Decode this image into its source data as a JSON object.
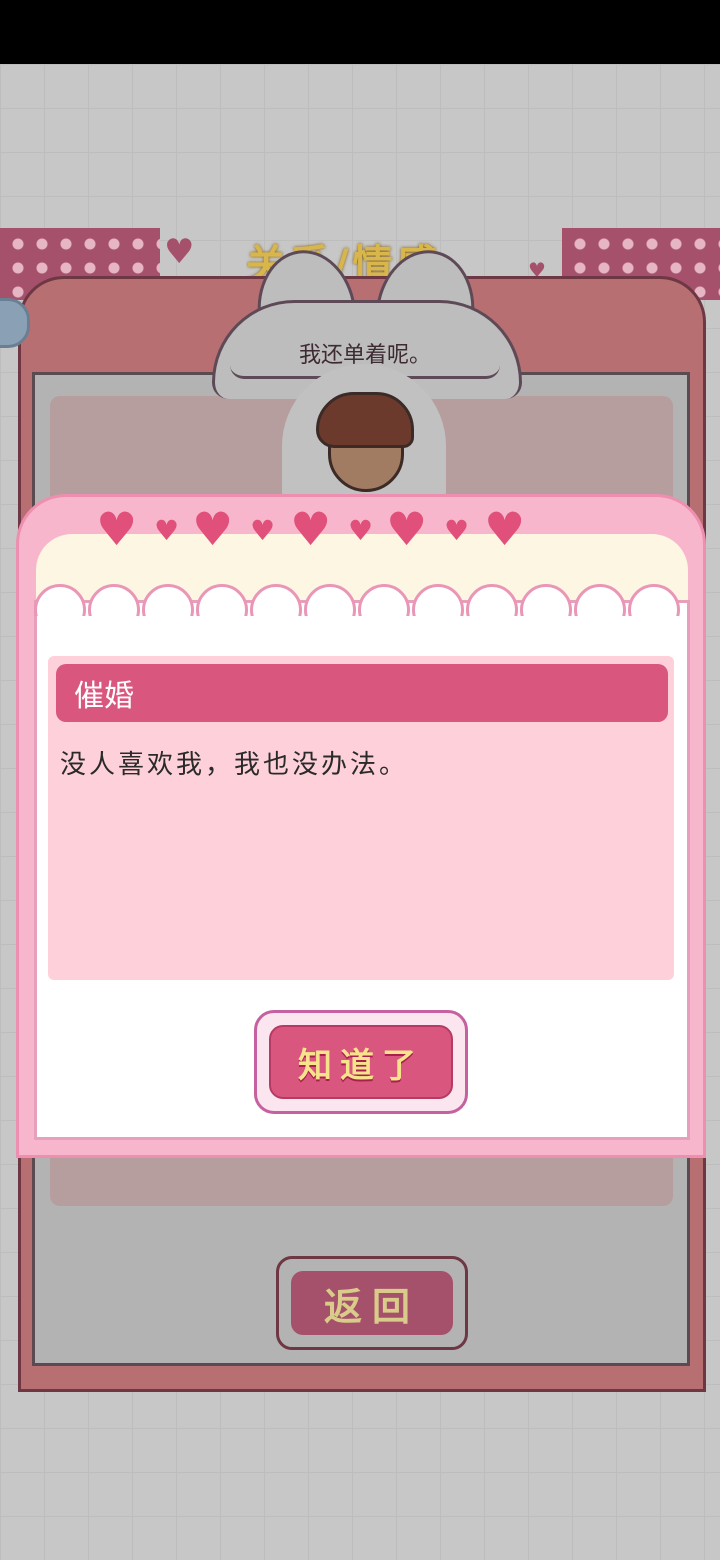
{
  "background": {
    "title": "关系/情感"
  },
  "npc": {
    "speech": "我还单着呢。"
  },
  "event_dialog": {
    "title": "催婚",
    "description": "没人喜欢我，我也没办法。",
    "confirm_label": "知道了"
  },
  "back_panel": {
    "back_label": "返回"
  },
  "colors": {
    "accent_pink": "#d9577f",
    "panel_rose": "#b86f72",
    "button_text_yellow": "#f6e38c"
  }
}
